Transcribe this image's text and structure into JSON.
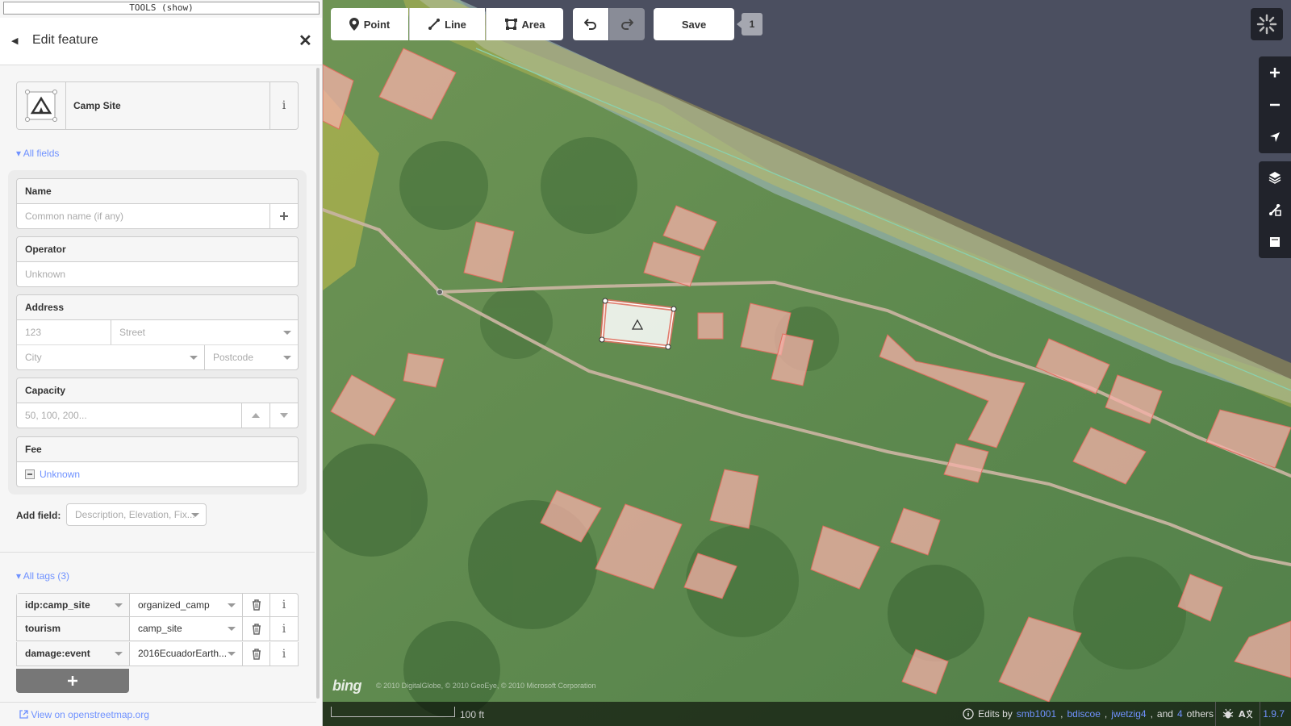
{
  "toolbar": {
    "point_label": "Point",
    "line_label": "Line",
    "area_label": "Area",
    "save_label": "Save",
    "edit_count": "1"
  },
  "sidebar": {
    "tools_bar": "TOOLS (show)",
    "title": "Edit feature",
    "preset_name": "Camp Site",
    "all_fields_label": "All fields",
    "fields": {
      "name_label": "Name",
      "name_placeholder": "Common name (if any)",
      "operator_label": "Operator",
      "operator_placeholder": "Unknown",
      "address_label": "Address",
      "housenumber_placeholder": "123",
      "street_placeholder": "Street",
      "city_placeholder": "City",
      "postcode_placeholder": "Postcode",
      "capacity_label": "Capacity",
      "capacity_placeholder": "50, 100, 200...",
      "fee_label": "Fee",
      "fee_value": "Unknown"
    },
    "add_field_label": "Add field:",
    "add_field_placeholder": "Description, Elevation, Fix...",
    "all_tags_label": "All tags (3)",
    "tags": [
      {
        "key": "idp:camp_site",
        "value": "organized_camp"
      },
      {
        "key": "tourism",
        "value": "camp_site"
      },
      {
        "key": "damage:event",
        "value": "2016EcuadorEarth..."
      }
    ],
    "osm_link": "View on openstreetmap.org"
  },
  "map": {
    "attribution": "© 2010 DigitalGlobe, © 2010 GeoEye, © 2010 Microsoft Corporation",
    "bing_logo": "bing",
    "scale_label": "100 ft",
    "edits_by": "Edits by",
    "contributors": [
      "smb1001",
      "bdiscoe",
      "jwetzig4"
    ],
    "and_text": "and",
    "others_count": "4",
    "others_text": "others",
    "version": "1.9.7"
  },
  "colors": {
    "accent": "#7092ff",
    "building_fill": "#f5b0a8",
    "building_stroke": "#e06e5f",
    "path": "#c8b4a0"
  },
  "icons": [
    "point-icon",
    "line-icon",
    "area-icon",
    "undo-icon",
    "redo-icon",
    "spinner-icon",
    "zoom-in-icon",
    "zoom-out-icon",
    "geolocate-icon",
    "layers-icon",
    "map-data-icon",
    "history-icon",
    "campsite-icon",
    "info-icon",
    "plus-icon",
    "trash-icon",
    "help-icon",
    "bug-icon",
    "translate-icon"
  ]
}
